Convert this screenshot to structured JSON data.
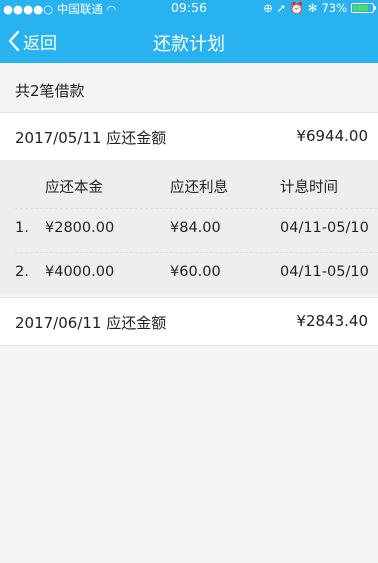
{
  "status_bar": {
    "carrier": "●●●●○ 中国联通",
    "wifi_glyph": "◠",
    "time": "09:56",
    "right_icons": "⊕ ➚ ⏰ ✻",
    "battery": "73%"
  },
  "nav": {
    "back_label": "返回",
    "title": "还款计划"
  },
  "summary": "共2笔借款",
  "plans": [
    {
      "date_label": "2017/05/11 应还金额",
      "amount": "¥6944.00",
      "headers": [
        "应还本金",
        "应还利息",
        "计息时间"
      ],
      "rows": [
        {
          "index": "1.",
          "principal": "¥2800.00",
          "interest": "¥84.00",
          "period": "04/11-05/10"
        },
        {
          "index": "2.",
          "principal": "¥4000.00",
          "interest": "¥60.00",
          "period": "04/11-05/10"
        }
      ]
    },
    {
      "date_label": "2017/06/11 应还金额",
      "amount": "¥2843.40"
    }
  ],
  "colors": {
    "accent": "#29b2f0",
    "battery_fill": "#4cd964",
    "table_bg": "#eeeeee"
  }
}
